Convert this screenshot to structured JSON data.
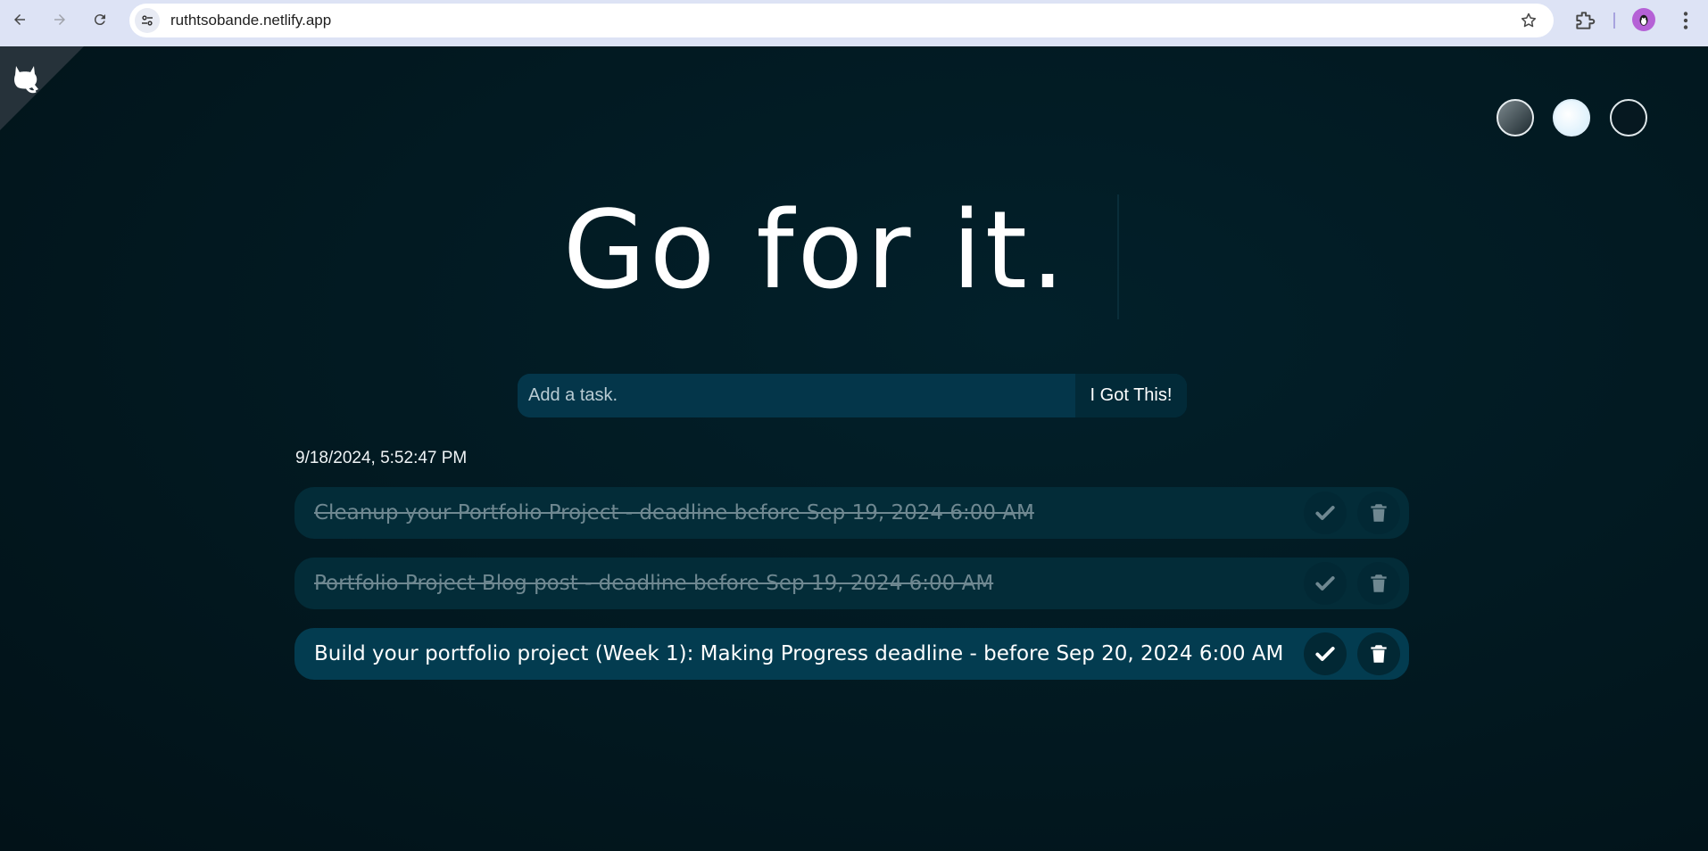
{
  "browser": {
    "url": "ruthtsobande.netlify.app"
  },
  "page": {
    "title": "Go for it.",
    "form": {
      "placeholder": "Add a task.",
      "submit_label": "I Got This!"
    },
    "datetime": "9/18/2024, 5:52:47 PM",
    "themes": [
      "standard",
      "light",
      "darker"
    ],
    "tasks": [
      {
        "text": "Cleanup your Portfolio Project - deadline before Sep 19, 2024 6:00 AM",
        "completed": true
      },
      {
        "text": "Portfolio Project Blog post - deadline before Sep 19, 2024 6:00 AM",
        "completed": true
      },
      {
        "text": "Build your portfolio project (Week 1): Making Progress deadline - before Sep 20, 2024 6:00 AM",
        "completed": false
      }
    ]
  },
  "colors": {
    "background": "#021a22",
    "input_bg": "#04364a",
    "task_done_bg": "#032c38",
    "task_active_bg": "#033c50"
  }
}
